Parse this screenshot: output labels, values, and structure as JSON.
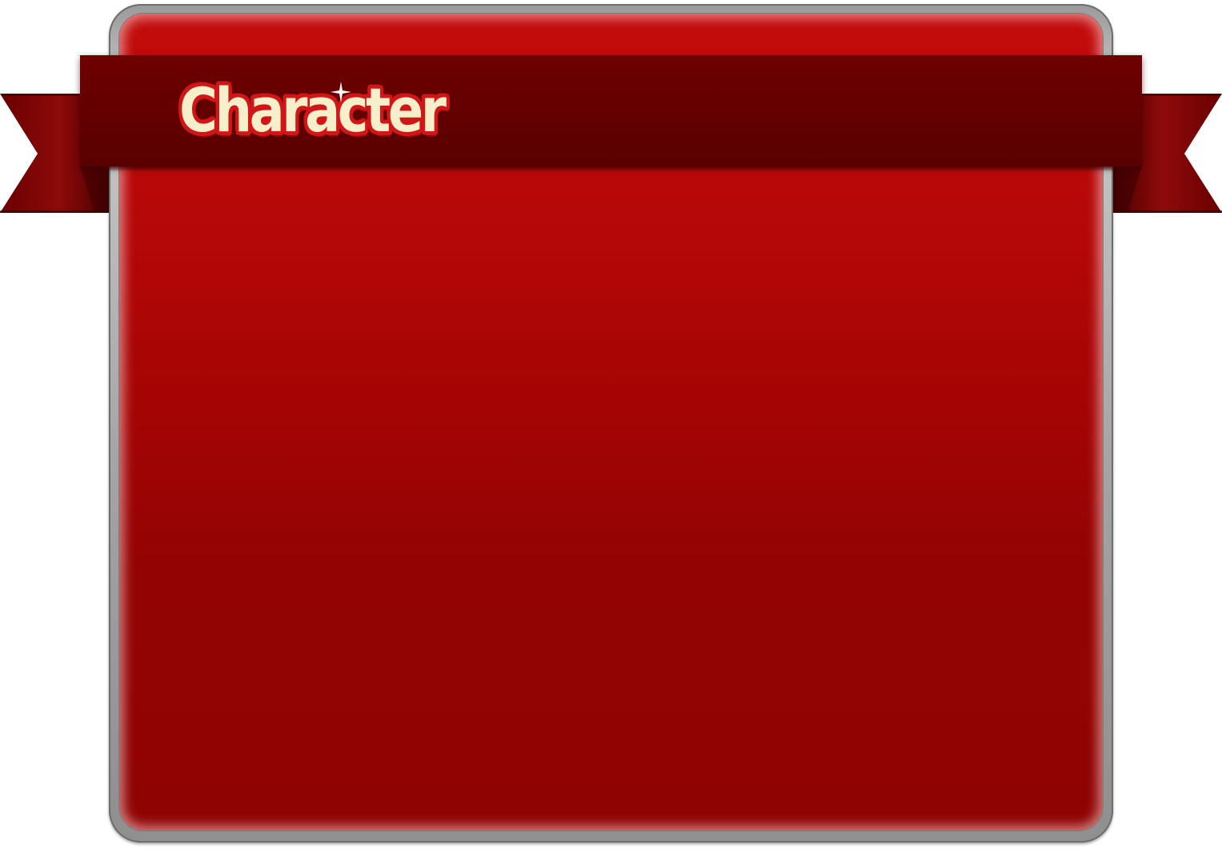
{
  "window": {
    "title": "Character"
  },
  "colors": {
    "panel_top": "#c40c0c",
    "panel_bottom": "#900303",
    "ribbon": "#640000",
    "ribbon_tail": "#8a0a0a",
    "title_fill": "#f7efc9",
    "title_outline": "#d01616",
    "frame": "#a4a4a4"
  },
  "icons": {
    "sparkle": "sparkle-icon"
  }
}
